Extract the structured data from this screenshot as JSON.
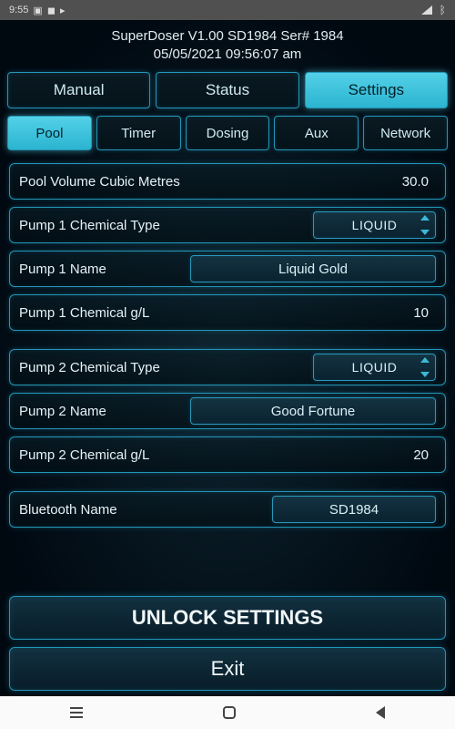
{
  "status": {
    "time": "9:55",
    "bluetooth": "⟡"
  },
  "header": {
    "line1": "SuperDoser V1.00  SD1984 Ser# 1984",
    "line2": "05/05/2021 09:56:07 am"
  },
  "main_tabs": {
    "manual": "Manual",
    "status": "Status",
    "settings": "Settings",
    "active": "settings"
  },
  "sub_tabs": {
    "pool": "Pool",
    "timer": "Timer",
    "dosing": "Dosing",
    "aux": "Aux",
    "network": "Network",
    "active": "pool"
  },
  "fields": {
    "pool_volume": {
      "label": "Pool Volume Cubic Metres",
      "value": "30.0"
    },
    "pump1_type": {
      "label": "Pump 1 Chemical Type",
      "value": "LIQUID"
    },
    "pump1_name": {
      "label": "Pump 1 Name",
      "value": "Liquid Gold"
    },
    "pump1_gpl": {
      "label": "Pump 1 Chemical g/L",
      "value": "10"
    },
    "pump2_type": {
      "label": "Pump 2 Chemical Type",
      "value": "LIQUID"
    },
    "pump2_name": {
      "label": "Pump 2 Name",
      "value": "Good Fortune"
    },
    "pump2_gpl": {
      "label": "Pump 2 Chemical g/L",
      "value": "20"
    },
    "bt_name": {
      "label": "Bluetooth Name",
      "value": "SD1984"
    }
  },
  "buttons": {
    "unlock": "UNLOCK SETTINGS",
    "exit": "Exit"
  }
}
